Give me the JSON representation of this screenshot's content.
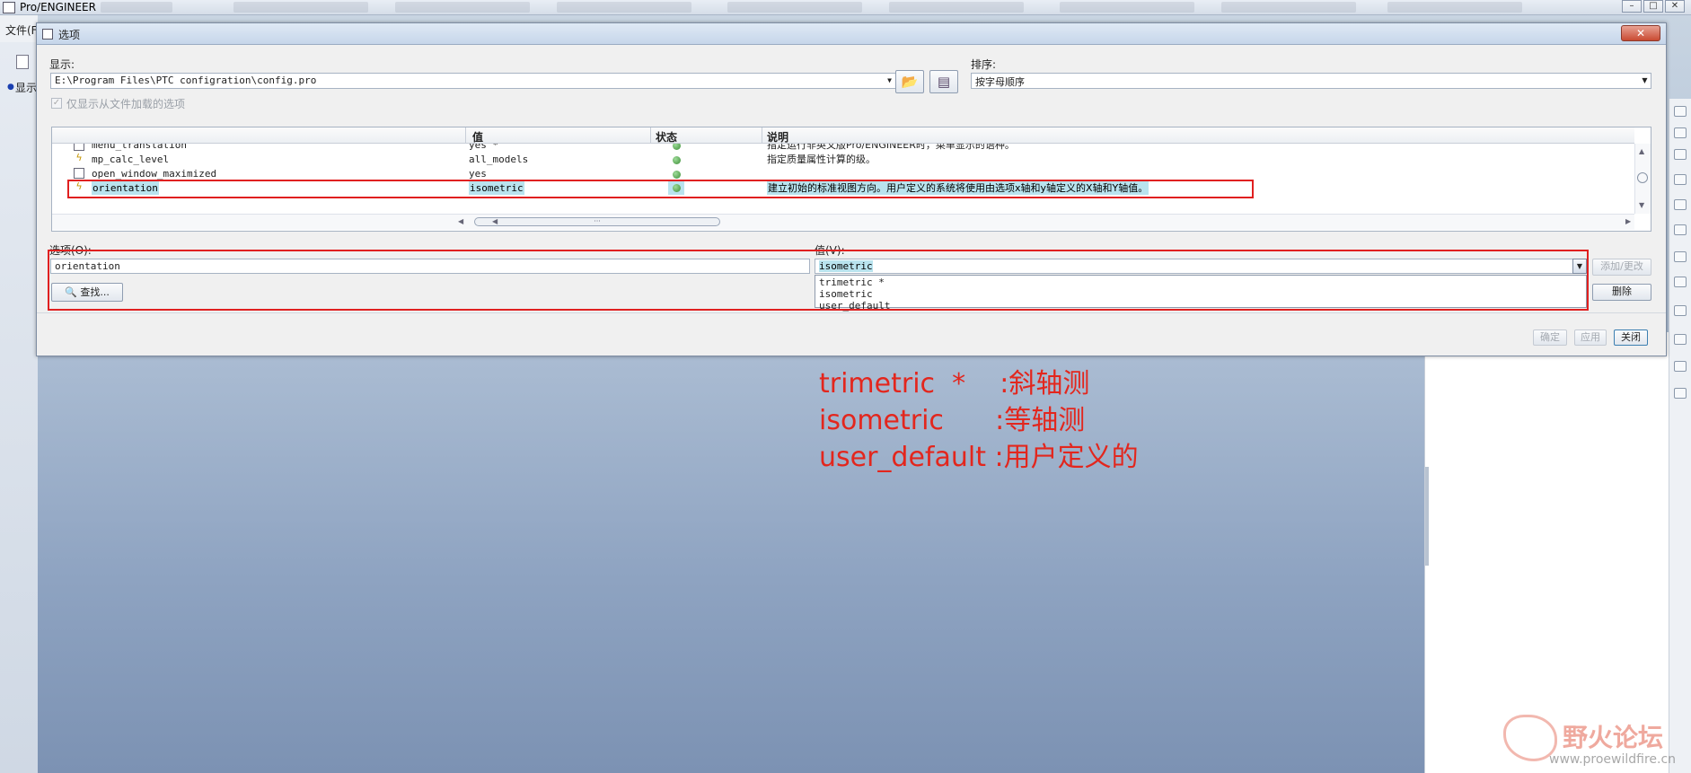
{
  "app": {
    "title": "Pro/ENGINEER",
    "menu_file": "文件(F",
    "left_tree_item": "显示"
  },
  "dialog": {
    "title": "选项",
    "close_label": "✕",
    "show_label": "显示:",
    "show_path": "E:\\Program Files\\PTC configration\\config.pro",
    "sort_label": "排序:",
    "sort_value": "按字母顺序",
    "only_loaded_label": "仅显示从文件加载的选项",
    "table": {
      "headers": {
        "value": "值",
        "status": "状态",
        "description": "说明"
      },
      "rows": [
        {
          "name": "menu_translation",
          "value": "yes *",
          "description": "指定运行非英文版Pro/ENGINEER时，菜单显示的语种。",
          "icon": "option-icon"
        },
        {
          "name": "mp_calc_level",
          "value": "all_models",
          "description": "指定质量属性计算的级。",
          "icon": "lightning-icon"
        },
        {
          "name": "open_window_maximized",
          "value": "yes",
          "description": "",
          "icon": "option-icon"
        },
        {
          "name": "orientation",
          "value": "isometric",
          "description": "建立初始的标准视图方向。用户定义的系统将使用由选项x轴和y轴定义的X轴和Y轴值。",
          "icon": "lightning-icon"
        }
      ],
      "scroll_marker": "···"
    },
    "option_label": "选项(O):",
    "option_value": "orientation",
    "value_label": "值(V):",
    "value_current": "isometric",
    "value_options": [
      "trimetric *",
      "isometric",
      "user_default"
    ],
    "find_button": "查找...",
    "add_change_button": "添加/更改",
    "delete_button": "删除",
    "ok_button": "确定",
    "apply_button": "应用",
    "close_button": "关闭"
  },
  "annotation": {
    "line1": "trimetric  *    :斜轴测",
    "line2": "isometric      :等轴测",
    "line3": "user_default :用户定义的"
  },
  "watermark": {
    "text": "野火论坛",
    "url": "www.proewildfire.cn"
  },
  "colors": {
    "annotation_red": "#e3261d",
    "selection": "#b9e3ee",
    "status_green": "#3b8d36"
  }
}
